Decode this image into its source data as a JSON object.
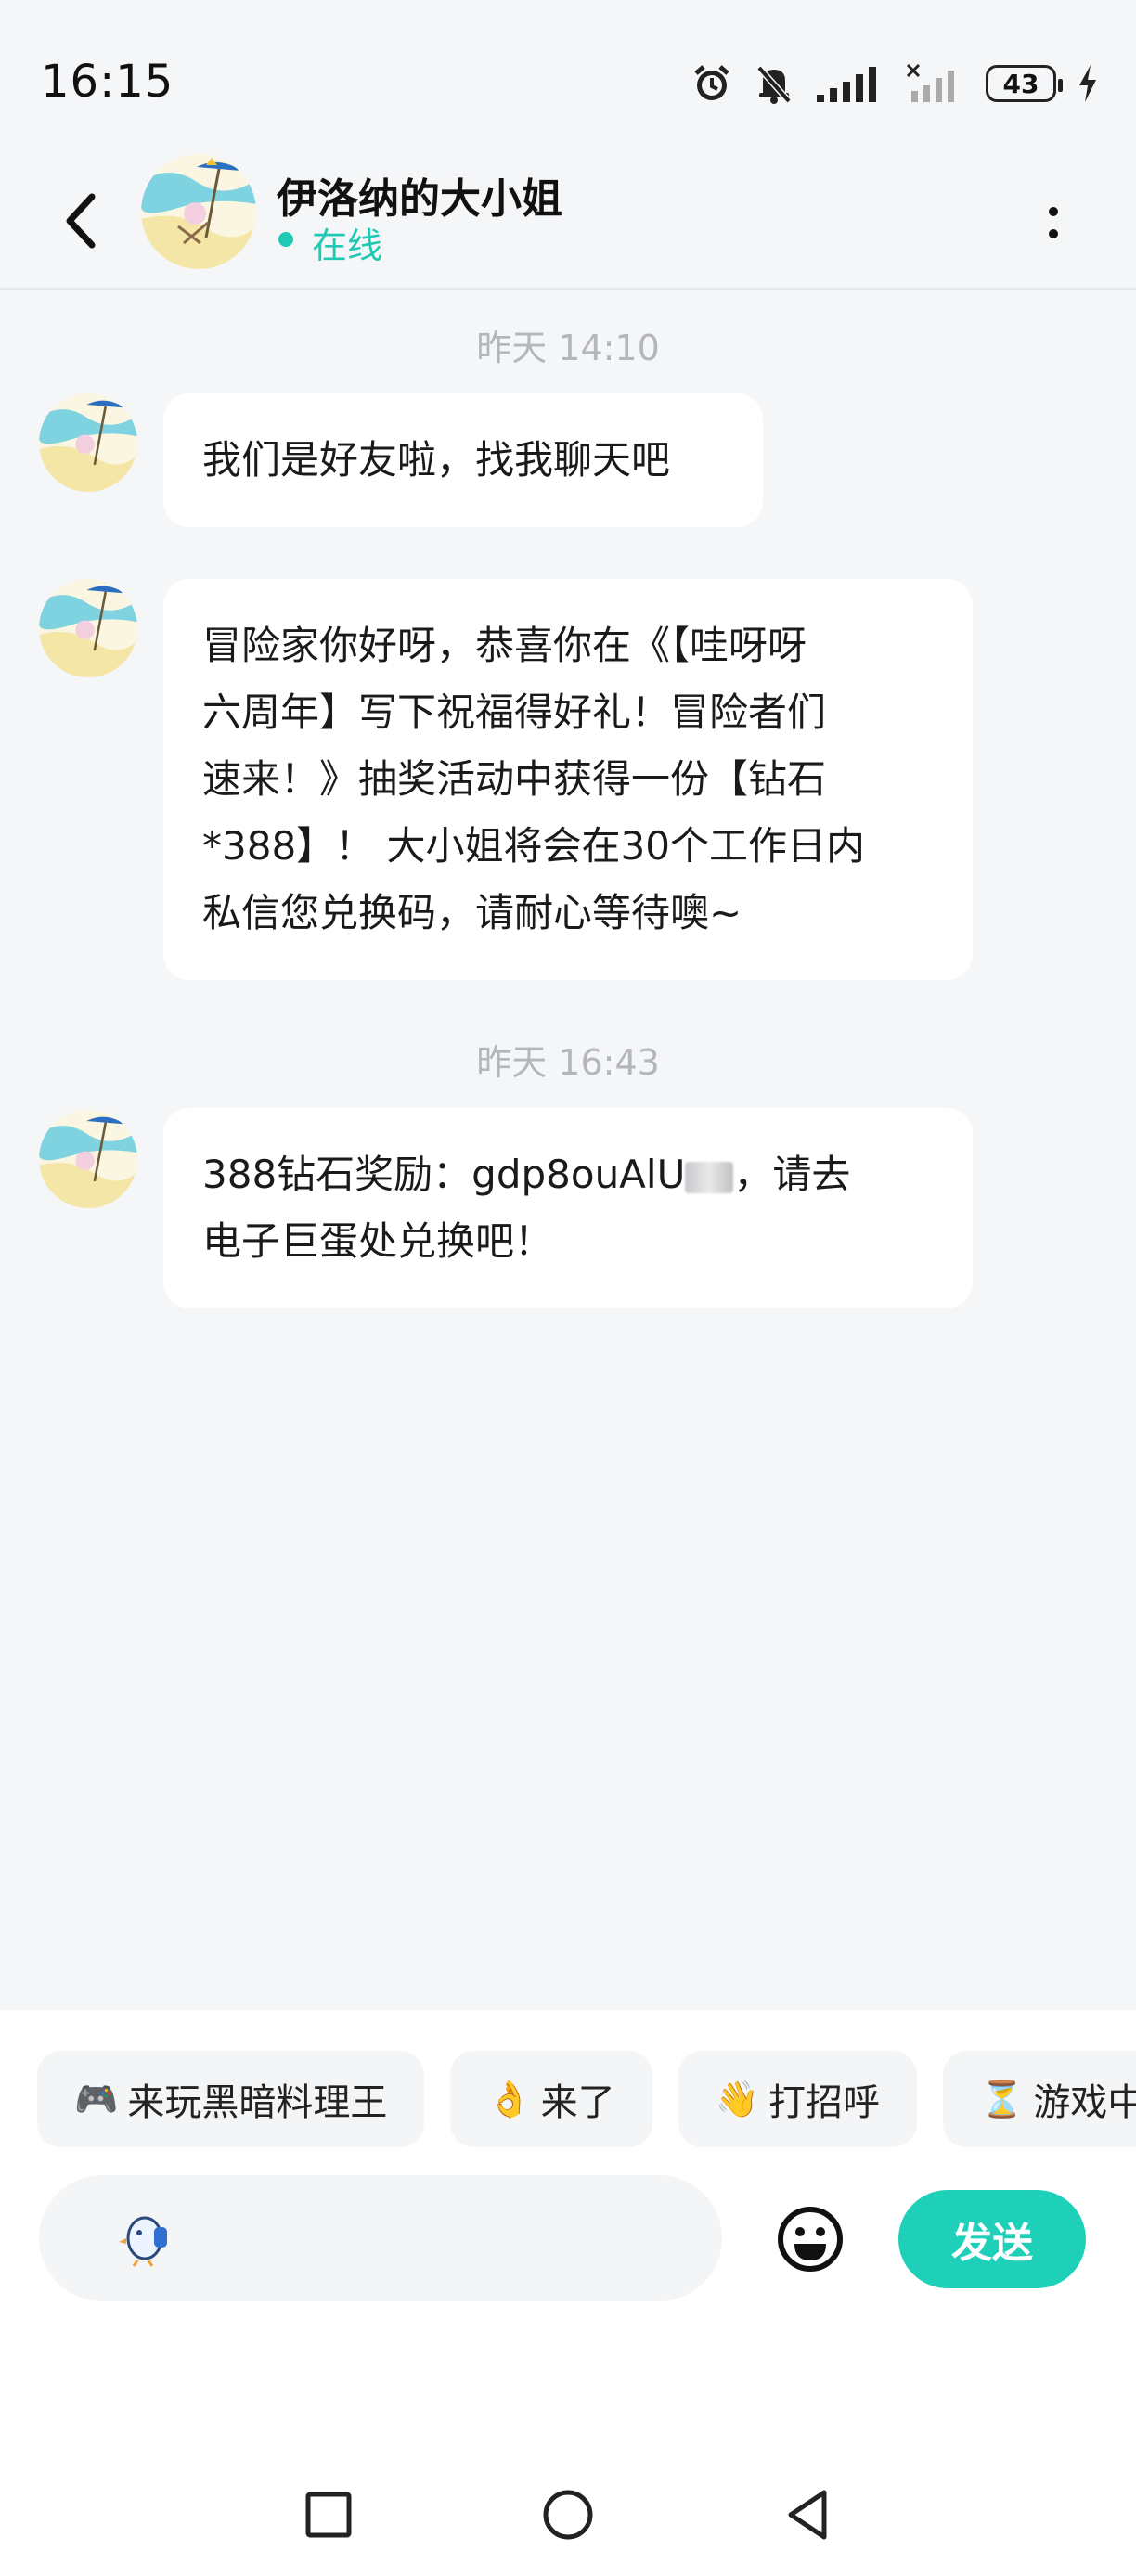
{
  "status_bar": {
    "time": "16:15",
    "battery": "43",
    "icons": [
      "alarm-icon",
      "bell-muted-icon",
      "signal-icon",
      "signal-no-service-icon",
      "battery-icon",
      "charging-icon"
    ]
  },
  "header": {
    "contact_name": "伊洛纳的大小姐",
    "presence": "在线",
    "presence_color": "#1fc9b4"
  },
  "messages": [
    {
      "timestamp": "昨天  14:10"
    },
    {
      "text": "我们是好友啦，找我聊天吧"
    },
    {
      "text_lines": [
        "冒险家你好呀，恭喜你在《【哇呀呀",
        "六周年】写下祝福得好礼！冒险者们",
        "速来！》抽奖活动中获得一份【钻石",
        "*388】！ 大小姐将会在30个工作日内",
        "私信您兑换码，请耐心等待噢~"
      ]
    },
    {
      "timestamp": "昨天  16:43"
    },
    {
      "line1_prefix": "388钻石奖励：gdp8ouAlU",
      "line1_suffix": "，请去",
      "line2": "电子巨蛋处兑换吧！"
    }
  ],
  "quick_replies": [
    {
      "icon": "🎮",
      "label": "来玩黑暗料理王"
    },
    {
      "icon": "👌",
      "label": "来了"
    },
    {
      "icon": "👋",
      "label": "打招呼"
    },
    {
      "icon": "⏳",
      "label": "游戏中"
    }
  ],
  "composer": {
    "placeholder": "",
    "send_label": "发送",
    "accent_color": "#1fd0b9"
  },
  "nav": {
    "icons": [
      "recent-apps-icon",
      "home-icon",
      "back-triangle-icon"
    ]
  }
}
